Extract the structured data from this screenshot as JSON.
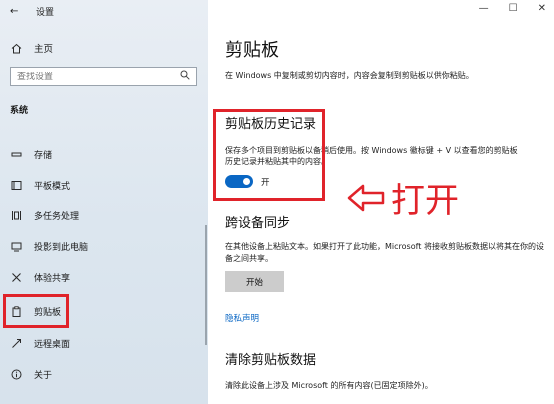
{
  "window": {
    "title": "设置",
    "back_icon": "back-arrow-icon",
    "controls": {
      "minimize": "—",
      "maximize": "☐",
      "close": "✕"
    }
  },
  "sidebar": {
    "home_label": "主页",
    "search_placeholder": "查找设置",
    "section_label": "系统",
    "items": [
      {
        "label": "存储",
        "icon": "storage-icon"
      },
      {
        "label": "平板模式",
        "icon": "tablet-mode-icon"
      },
      {
        "label": "多任务处理",
        "icon": "multitasking-icon"
      },
      {
        "label": "投影到此电脑",
        "icon": "project-icon"
      },
      {
        "label": "体验共享",
        "icon": "shared-experiences-icon"
      },
      {
        "label": "剪贴板",
        "icon": "clipboard-icon",
        "selected": true
      },
      {
        "label": "远程桌面",
        "icon": "remote-desktop-icon"
      },
      {
        "label": "关于",
        "icon": "info-icon"
      }
    ]
  },
  "main": {
    "title": "剪贴板",
    "description": "在 Windows 中复制或剪切内容时，内容会复制到剪贴板以供你粘贴。",
    "history": {
      "heading": "剪贴板历史记录",
      "description": "保存多个项目到剪贴板以备稍后使用。按 Windows 徽标键 + V 以查看您的剪贴板历史记录并粘贴其中的内容。",
      "toggle_label": "开",
      "toggle_on": true
    },
    "sync": {
      "heading": "跨设备同步",
      "description": "在其他设备上粘贴文本。如果打开了此功能，Microsoft 将接收剪贴板数据以将其在你的设备之间共享。",
      "button_label": "开始"
    },
    "privacy_link": "隐私声明",
    "clear": {
      "heading": "清除剪贴板数据",
      "description": "清除此设备上涉及 Microsoft 的所有内容(已固定项除外)。"
    }
  },
  "annotation": {
    "text": "打开"
  },
  "colors": {
    "accent": "#0a67c4",
    "highlight": "#e0232a"
  }
}
